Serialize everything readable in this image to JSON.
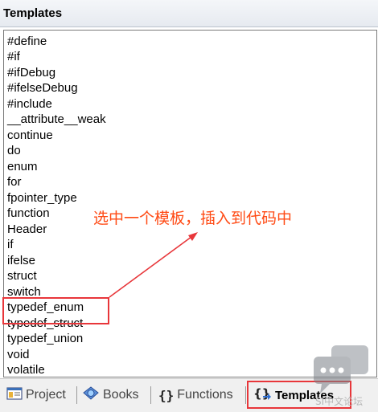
{
  "panel": {
    "title": "Templates"
  },
  "templates": {
    "items": [
      "#define",
      "#if",
      "#ifDebug",
      "#ifelseDebug",
      "#include",
      "__attribute__weak",
      "continue",
      "do",
      "enum",
      "for",
      "fpointer_type",
      "function",
      "Header",
      "if",
      "ifelse",
      "struct",
      "switch",
      "typedef_enum",
      "typedef_struct",
      "typedef_union",
      "void",
      "volatile"
    ],
    "highlighted": "typedef_enum"
  },
  "tabs": {
    "project": "Project",
    "books": "Books",
    "functions": "Functions",
    "templates": "Templates",
    "active": "Templates"
  },
  "annotation": {
    "text": "选中一个模板，插入到代码中"
  },
  "watermark": {
    "text": "SI中文论坛"
  },
  "colors": {
    "annotation": "#ff4a14",
    "highlight_box": "#e8363a"
  },
  "icons": [
    "project-icon",
    "books-icon",
    "functions-icon",
    "templates-icon",
    "chat-bubble-icon"
  ]
}
